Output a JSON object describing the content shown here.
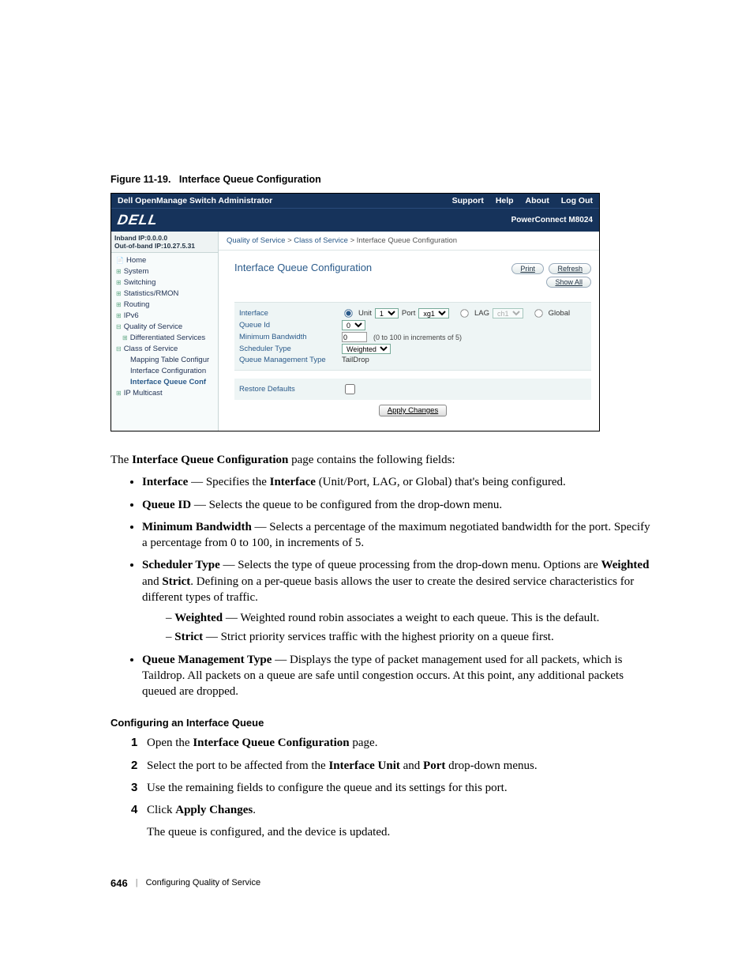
{
  "figure": {
    "label": "Figure 11-19.",
    "title": "Interface Queue Configuration"
  },
  "shot": {
    "header": {
      "title": "Dell OpenManage Switch Administrator",
      "links": [
        "Support",
        "Help",
        "About",
        "Log Out"
      ]
    },
    "brand": {
      "logo": "DELL",
      "product": "PowerConnect M8024"
    },
    "nav": {
      "ip1": "Inband IP:0.0.0.0",
      "ip2": "Out-of-band IP:10.27.5.31",
      "items": [
        {
          "label": "Home",
          "cls": "home"
        },
        {
          "label": "System",
          "cls": "lvl1"
        },
        {
          "label": "Switching",
          "cls": "lvl1"
        },
        {
          "label": "Statistics/RMON",
          "cls": "lvl1"
        },
        {
          "label": "Routing",
          "cls": "lvl1"
        },
        {
          "label": "IPv6",
          "cls": "lvl1"
        },
        {
          "label": "Quality of Service",
          "cls": "lvl1open"
        },
        {
          "label": "Differentiated Services",
          "cls": "lvl2"
        },
        {
          "label": "Class of Service",
          "cls": "lvl2open"
        },
        {
          "label": "Mapping Table Configur",
          "cls": "lvl3"
        },
        {
          "label": "Interface Configuration",
          "cls": "lvl3"
        },
        {
          "label": "Interface Queue Conf",
          "cls": "lvl3 active"
        },
        {
          "label": "IP Multicast",
          "cls": "lvl1"
        }
      ]
    },
    "crumb": {
      "a": "Quality of Service",
      "b": "Class of Service",
      "c": "Interface Queue Configuration",
      "sep": " > "
    },
    "panel": {
      "title": "Interface Queue Configuration",
      "print": "Print",
      "refresh": "Refresh",
      "showall": "Show All",
      "rows": {
        "interface": "Interface",
        "unit": "Unit",
        "unit_v": "1",
        "port": "Port",
        "port_v": "xg1",
        "lag": "LAG",
        "lag_v": "ch1",
        "global": "Global",
        "queueid": "Queue Id",
        "queueid_v": "0",
        "minbw": "Minimum Bandwidth",
        "minbw_v": "0",
        "minbw_hint": "(0 to 100 in increments of 5)",
        "sched": "Scheduler Type",
        "sched_v": "Weighted",
        "qmt": "Queue Management Type",
        "qmt_v": "TailDrop"
      },
      "restore": "Restore Defaults",
      "apply": "Apply Changes"
    }
  },
  "doc": {
    "intro_a": "The ",
    "intro_b": "Interface Queue Configuration",
    "intro_c": " page contains the following fields:",
    "b1": {
      "t": "Interface",
      "d": " — Specifies the ",
      "t2": "Interface",
      "d2": " (Unit/Port, LAG, or Global) that's being configured."
    },
    "b2": {
      "t": "Queue ID",
      "d": " — Selects the queue to be configured from the drop-down menu."
    },
    "b3": {
      "t": "Minimum Bandwidth",
      "d": " — Selects a percentage of the maximum negotiated bandwidth for the port. Specify a percentage from 0 to 100, in increments of 5."
    },
    "b4": {
      "t": "Scheduler Type",
      "d": " — Selects the type of queue processing from the drop-down menu. Options are ",
      "t2": "Weighted",
      "d2": " and ",
      "t3": "Strict",
      "d3": ". Defining on a per-queue basis allows the user to create the desired service characteristics for different types of traffic."
    },
    "b4a": {
      "t": "Weighted",
      "d": " — Weighted round robin associates a weight to each queue. This is the default."
    },
    "b4b": {
      "t": "Strict",
      "d": " — Strict priority services traffic with the highest priority on a queue first."
    },
    "b5": {
      "t": "Queue Management Type",
      "d": " — Displays the type of packet management used for all packets, which is Taildrop. All packets on a queue are safe until congestion occurs. At this point, any additional packets queued are dropped."
    },
    "section": "Configuring an Interface Queue",
    "s1a": "Open the ",
    "s1b": "Interface Queue Configuration",
    "s1c": " page.",
    "s2a": "Select the port to be affected from the ",
    "s2b": "Interface Unit",
    "s2c": " and ",
    "s2d": "Port",
    "s2e": " drop-down menus.",
    "s3": "Use the remaining fields to configure the queue and its settings for this port.",
    "s4a": "Click ",
    "s4b": "Apply Changes",
    "s4c": ".",
    "s4note": "The queue is configured, and the device is updated.",
    "footer_page": "646",
    "footer_sep": "|",
    "footer_title": "Configuring Quality of Service"
  }
}
